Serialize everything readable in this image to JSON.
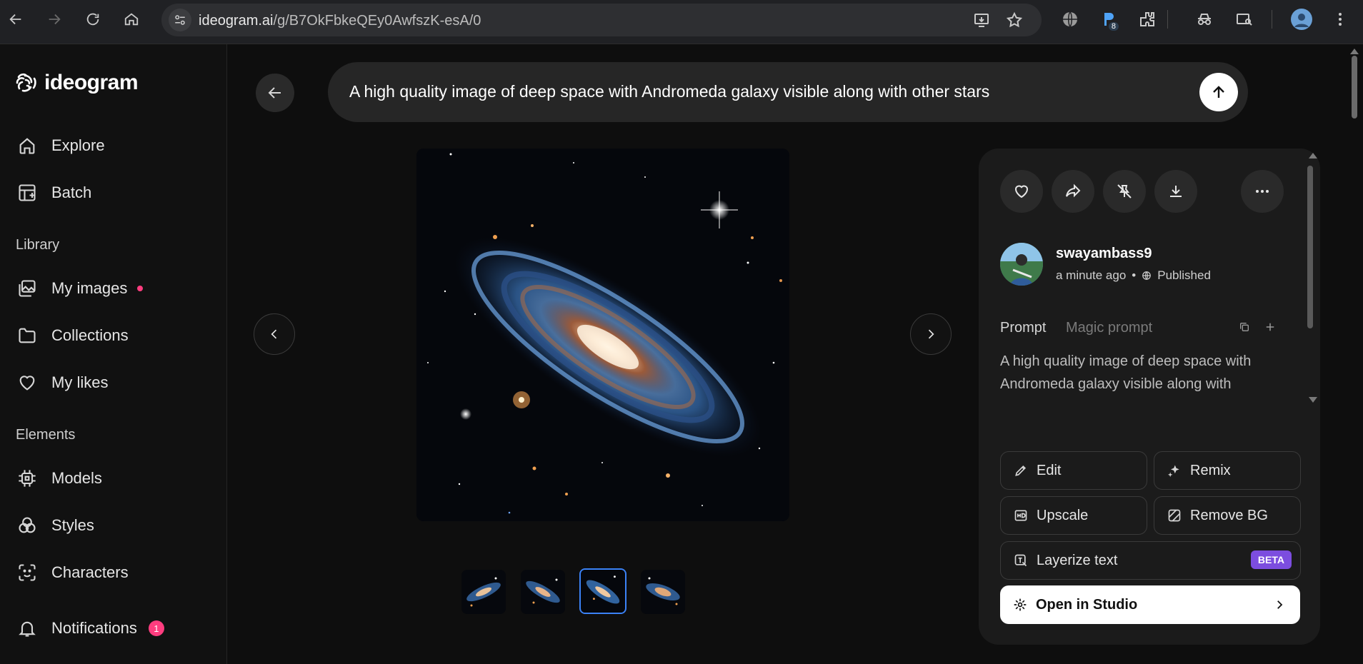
{
  "browser": {
    "url_host": "ideogram.ai",
    "url_path": "/g/B7OkFbkeQEy0AwfszK-esA/0",
    "extension_badge": "8"
  },
  "sidebar": {
    "brand": "ideogram",
    "items": [
      {
        "label": "Explore",
        "icon": "home-icon"
      },
      {
        "label": "Batch",
        "icon": "batch-icon"
      }
    ],
    "library_heading": "Library",
    "library_items": [
      {
        "label": "My images",
        "icon": "images-icon"
      },
      {
        "label": "Collections",
        "icon": "folder-icon"
      },
      {
        "label": "My likes",
        "icon": "heart-icon"
      }
    ],
    "elements_heading": "Elements",
    "element_items": [
      {
        "label": "Models",
        "icon": "chip-icon"
      },
      {
        "label": "Styles",
        "icon": "styles-icon"
      },
      {
        "label": "Characters",
        "icon": "face-scan-icon"
      }
    ],
    "notifications": {
      "label": "Notifications",
      "count": "1"
    }
  },
  "main": {
    "prompt": "A high quality image of deep space with Andromeda galaxy visible along with other stars",
    "thumbnail_count": 4,
    "active_thumbnail": 3
  },
  "panel": {
    "username": "swayambass9",
    "time": "a minute ago",
    "separator": "•",
    "visibility": "Published",
    "tab_prompt": "Prompt",
    "tab_magic": "Magic prompt",
    "prompt_text": "A high quality image of deep space with Andromeda galaxy visible along with other stars",
    "actions": {
      "edit": "Edit",
      "remix": "Remix",
      "upscale": "Upscale",
      "remove_bg": "Remove BG",
      "layerize": "Layerize text",
      "beta": "BETA",
      "studio": "Open in Studio"
    }
  },
  "colors": {
    "accent_pink": "#ff3d7f",
    "beta_purple": "#7c4ddf",
    "active_blue": "#3b82f6"
  }
}
